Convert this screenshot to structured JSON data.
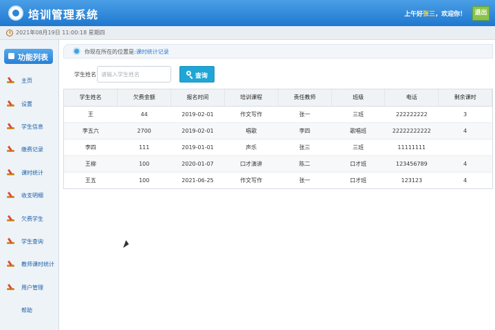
{
  "header": {
    "title": "培训管理系统",
    "greeting_prefix": "上午好",
    "username": "张三",
    "greeting_suffix": "，欢迎你！",
    "logout_label": "退出"
  },
  "datebar": {
    "text": "2021年08月19日 11:00:18 星期四"
  },
  "sidebar": {
    "heading": "功能列表",
    "items": [
      {
        "label": "主页"
      },
      {
        "label": "设置"
      },
      {
        "label": "学生信息"
      },
      {
        "label": "缴费记录"
      },
      {
        "label": "课时统计"
      },
      {
        "label": "收支明细"
      },
      {
        "label": "欠费学生"
      },
      {
        "label": "学生查询"
      },
      {
        "label": "教师课时统计"
      },
      {
        "label": "用户管理"
      },
      {
        "label": "帮助"
      }
    ]
  },
  "breadcrumb": {
    "prefix": "你现在所在的位置是:",
    "current": "课时统计记录"
  },
  "search": {
    "label": "学生姓名：",
    "placeholder": "请输入学生姓名",
    "button_label": "查询"
  },
  "table": {
    "columns": [
      "学生姓名",
      "欠费金额",
      "报名时间",
      "培训课程",
      "责任教师",
      "班级",
      "电话",
      "剩余课时"
    ],
    "rows": [
      [
        "王",
        "44",
        "2019-02-01",
        "作文写作",
        "张一",
        "三班",
        "222222222",
        "3"
      ],
      [
        "李五六",
        "2700",
        "2019-02-01",
        "唱歌",
        "李四",
        "歌唱班",
        "22222222222",
        "4"
      ],
      [
        "李四",
        "111",
        "2019-01-01",
        "声乐",
        "张三",
        "三班",
        "11111111",
        ""
      ],
      [
        "王柳",
        "100",
        "2020-01-07",
        "口才演讲",
        "陈二",
        "口才班",
        "123456789",
        "4"
      ],
      [
        "王五",
        "100",
        "2021-06-25",
        "作文写作",
        "张一",
        "口才班",
        "123123",
        "4"
      ]
    ]
  }
}
